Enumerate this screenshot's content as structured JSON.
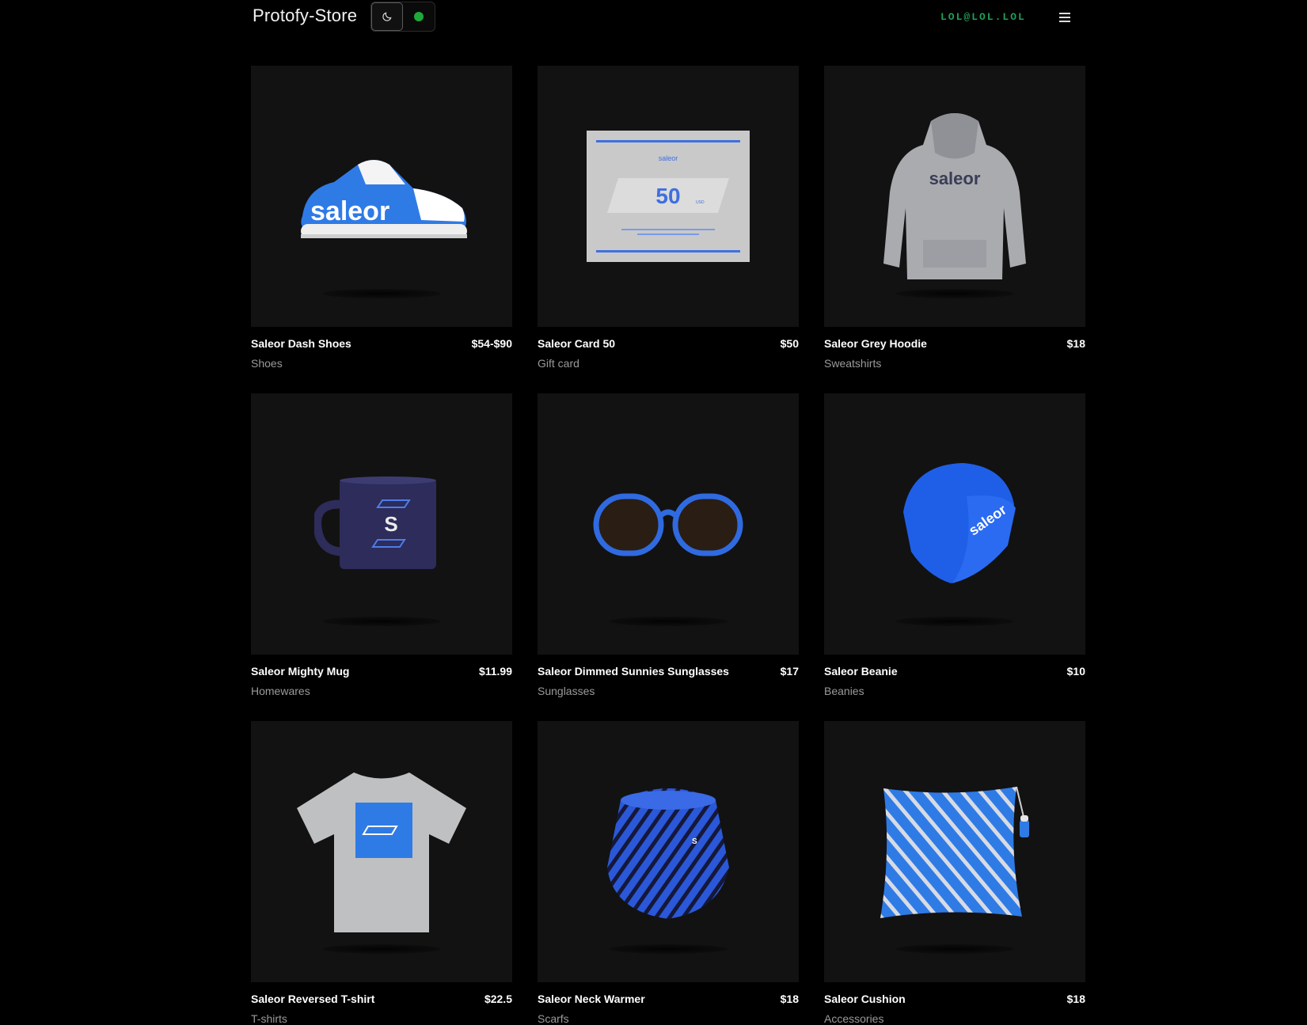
{
  "header": {
    "brand": "Protofy-Store",
    "user_email": "LOL@LOL.LOL",
    "icons": {
      "theme": "moon-icon",
      "status": "status-dot",
      "menu": "hamburger-menu-icon"
    },
    "colors": {
      "accent": "#1f9e55",
      "status": "#1fa83a"
    }
  },
  "products": [
    {
      "name": "Saleor Dash Shoes",
      "price": "$54-$90",
      "category": "Shoes"
    },
    {
      "name": "Saleor Card 50",
      "price": "$50",
      "category": "Gift card"
    },
    {
      "name": "Saleor Grey Hoodie",
      "price": "$18",
      "category": "Sweatshirts"
    },
    {
      "name": "Saleor Mighty Mug",
      "price": "$11.99",
      "category": "Homewares"
    },
    {
      "name": "Saleor Dimmed Sunnies Sunglasses",
      "price": "$17",
      "category": "Sunglasses"
    },
    {
      "name": "Saleor Beanie",
      "price": "$10",
      "category": "Beanies"
    },
    {
      "name": "Saleor Reversed T-shirt",
      "price": "$22.5",
      "category": "T-shirts"
    },
    {
      "name": "Saleor Neck Warmer",
      "price": "$18",
      "category": "Scarfs"
    },
    {
      "name": "Saleor Cushion",
      "price": "$18",
      "category": "Accessories"
    }
  ],
  "image_text": {
    "shoe_logo": "saleor",
    "card_logo": "saleor",
    "card_value": "50",
    "card_currency": "USD",
    "hoodie_logo": "saleor",
    "mug_logo": "S",
    "beanie_logo": "saleor",
    "neck_logo": "S"
  }
}
